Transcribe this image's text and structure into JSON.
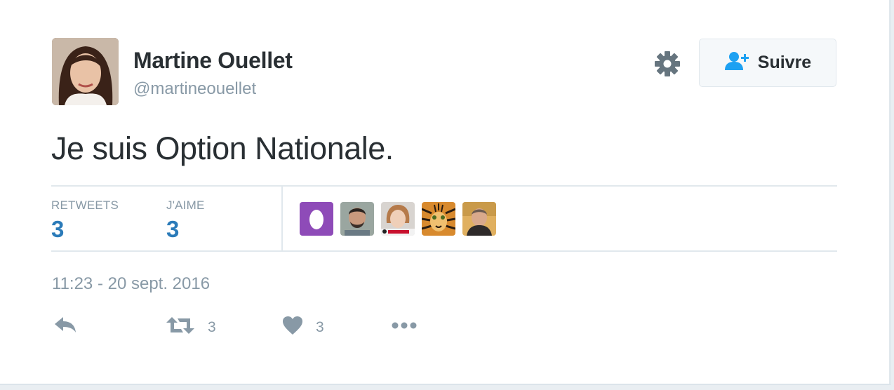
{
  "user": {
    "display_name": "Martine Ouellet",
    "handle": "@martineouellet",
    "follow_label": "Suivre"
  },
  "tweet": {
    "text": "Je suis Option Nationale.",
    "timestamp": "11:23 - 20 sept. 2016"
  },
  "stats": {
    "retweets_label": "RETWEETS",
    "retweets_value": "3",
    "likes_label": "J'AIME",
    "likes_value": "3"
  },
  "actions": {
    "retweet_count": "3",
    "like_count": "3"
  },
  "icons": {
    "settings": "gear-icon",
    "follow": "add-user-icon",
    "reply": "reply-icon",
    "retweet": "retweet-icon",
    "like": "heart-icon",
    "more": "more-icon"
  },
  "colors": {
    "text": "#292f33",
    "muted": "#8899a6",
    "count_blue": "#2b7bb9",
    "follow_icon": "#1da1f2",
    "divider": "#e1e8ed"
  }
}
